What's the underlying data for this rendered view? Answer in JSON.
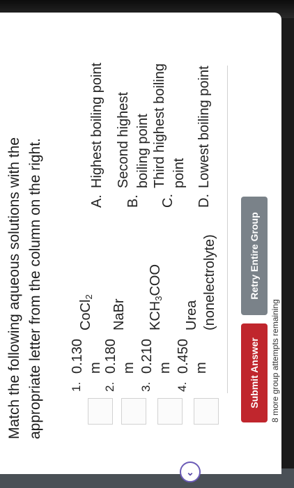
{
  "instructions": {
    "line1": "Match the following aqueous solutions with the",
    "line2": "appropriate letter from the column on the right."
  },
  "solutions": [
    {
      "num": "1.",
      "conc": "0.130",
      "unit": "m",
      "formula": "CoCl",
      "sub": "2",
      "extra": ""
    },
    {
      "num": "2.",
      "conc": "0.180",
      "unit": "m",
      "formula": "NaBr",
      "sub": "",
      "extra": ""
    },
    {
      "num": "3.",
      "conc": "0.210",
      "unit": "m",
      "formula": "KCH",
      "sub": "3",
      "formula_tail": "COO",
      "extra": ""
    },
    {
      "num": "4.",
      "conc": "0.450",
      "unit": "m",
      "formula": "Urea",
      "sub": "",
      "extra": "(nonelectrolyte)"
    }
  ],
  "options": [
    {
      "letter": "A.",
      "line1": "Highest boiling point",
      "line2": ""
    },
    {
      "letter": "B.",
      "line1": "Second highest",
      "line2": "boiling point"
    },
    {
      "letter": "C.",
      "line1": "Third highest boiling",
      "line2": "point"
    },
    {
      "letter": "D.",
      "line1": "Lowest boiling point",
      "line2": ""
    }
  ],
  "buttons": {
    "submit": "Submit Answer",
    "retry": "Retry Entire Group"
  },
  "attempts": "8 more group attempts remaining",
  "icons": {
    "chevron": "chevron-down-icon"
  },
  "colors": {
    "submit": "#c0262d",
    "retry": "#7a8289"
  }
}
